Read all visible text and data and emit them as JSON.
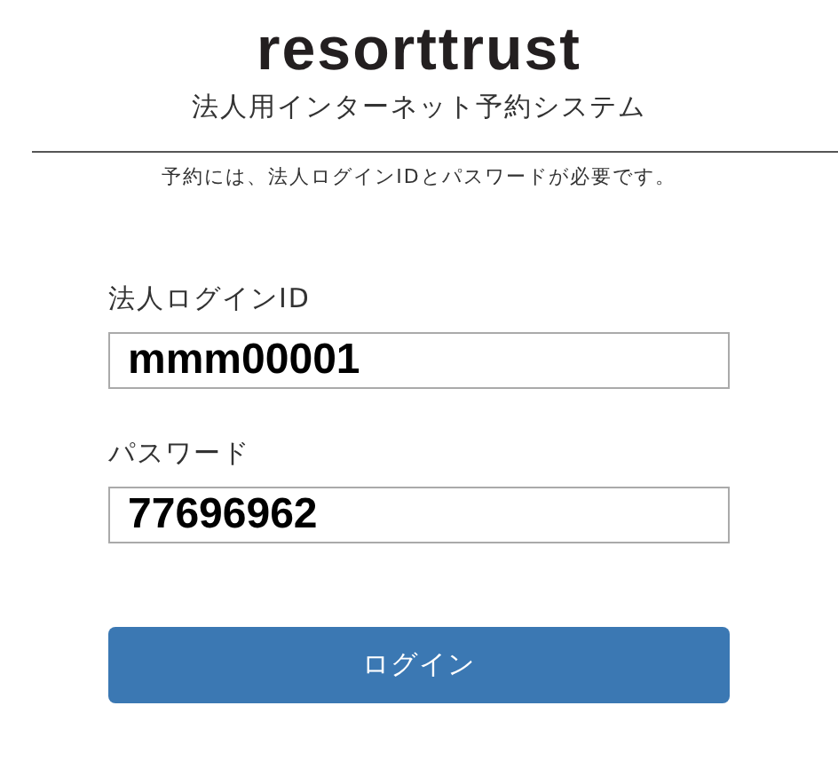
{
  "logo": "resorttrust",
  "subtitle": "法人用インターネット予約システム",
  "notice": "予約には、法人ログインIDとパスワードが必要です。",
  "fields": [
    {
      "label": "法人ログインID",
      "value": "mmm00001"
    },
    {
      "label": "パスワード",
      "value": "77696962"
    }
  ],
  "login_button": "ログイン"
}
